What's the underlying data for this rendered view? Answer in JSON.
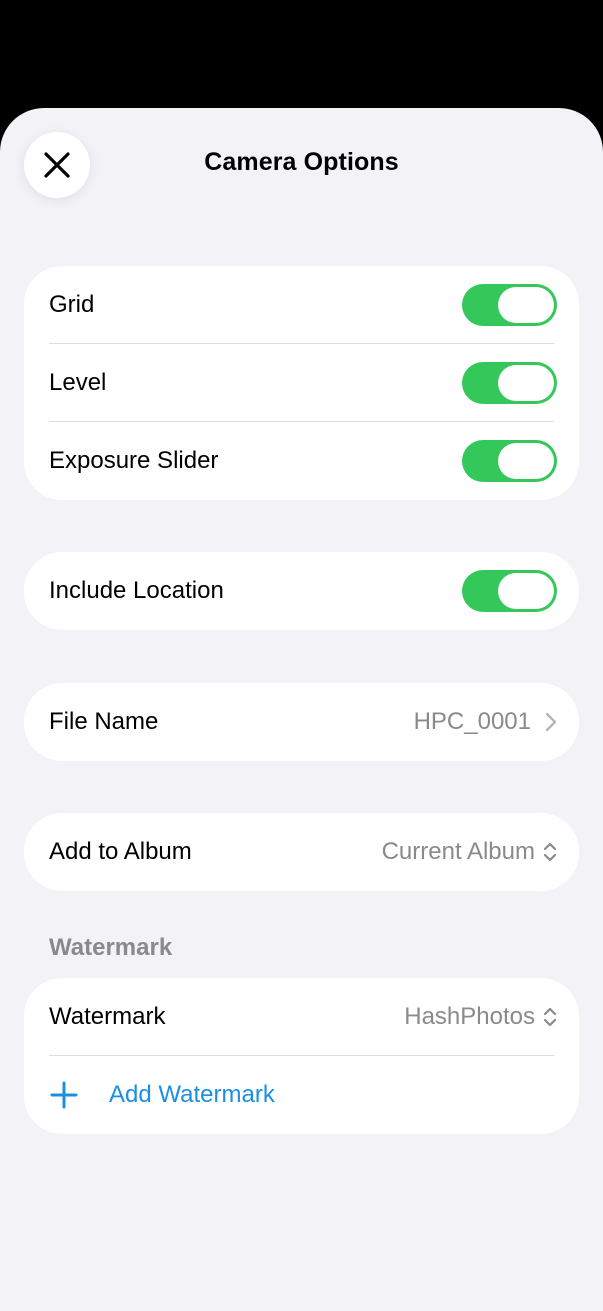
{
  "sheet": {
    "title": "Camera Options",
    "close_icon": "close-icon"
  },
  "toggles_group": [
    {
      "label": "Grid",
      "on": true
    },
    {
      "label": "Level",
      "on": true
    },
    {
      "label": "Exposure Slider",
      "on": true
    }
  ],
  "location": {
    "label": "Include Location",
    "on": true
  },
  "file_name": {
    "label": "File Name",
    "value": "HPC_0001",
    "icon": "chevron-right-icon"
  },
  "album": {
    "label": "Add to Album",
    "value": "Current Album",
    "icon": "chevron-up-down-icon"
  },
  "watermark_section": {
    "header": "Watermark",
    "watermark": {
      "label": "Watermark",
      "value": "HashPhotos",
      "icon": "chevron-up-down-icon"
    },
    "add": {
      "label": "Add Watermark",
      "icon": "plus-icon"
    }
  },
  "colors": {
    "toggle_on": "#34C759",
    "accent": "#1A8FE3",
    "background": "#F2F2F7",
    "secondary_text": "#8A8A8E"
  }
}
